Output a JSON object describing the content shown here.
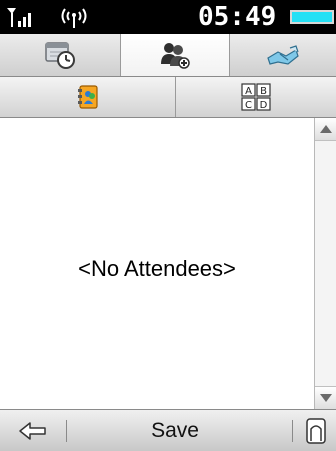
{
  "status_bar": {
    "time": "05:49",
    "signal_icon": "signal-strength-icon",
    "antenna_icon": "wireless-antenna-icon",
    "battery_icon": "battery-icon",
    "battery_color": "#23e0f5"
  },
  "tabs": [
    {
      "icon": "calendar-clock-icon",
      "active": false
    },
    {
      "icon": "add-attendee-icon",
      "active": true
    },
    {
      "icon": "handshake-icon",
      "active": false
    }
  ],
  "toolbar": {
    "contacts_icon": "contacts-book-icon",
    "abcd_icon": "abcd-letters-icon",
    "abcd_letters": [
      "A",
      "B",
      "C",
      "D"
    ]
  },
  "content": {
    "empty_message": "<No Attendees>"
  },
  "bottom_bar": {
    "back_icon": "back-arrow-icon",
    "save_label": "Save",
    "home_icon": "home-icon"
  }
}
